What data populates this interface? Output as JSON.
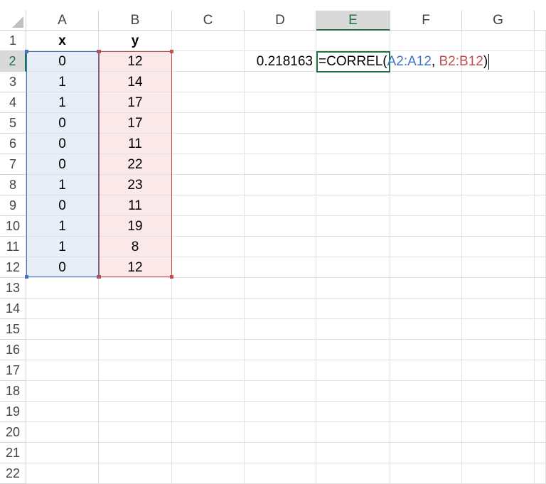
{
  "columns": [
    "A",
    "B",
    "C",
    "D",
    "E",
    "F",
    "G"
  ],
  "active_column": "E",
  "rows": [
    "1",
    "2",
    "3",
    "4",
    "5",
    "6",
    "7",
    "8",
    "9",
    "10",
    "11",
    "12",
    "13",
    "14",
    "15",
    "16",
    "17",
    "18",
    "19",
    "20",
    "21",
    "22"
  ],
  "active_row": "2",
  "headers": {
    "a1": "x",
    "b1": "y"
  },
  "col_a": [
    "0",
    "1",
    "1",
    "0",
    "0",
    "0",
    "1",
    "0",
    "1",
    "1",
    "0"
  ],
  "col_b": [
    "12",
    "14",
    "17",
    "17",
    "11",
    "22",
    "23",
    "11",
    "19",
    "8",
    "12"
  ],
  "d2_value": "0.218163",
  "formula": {
    "prefix": "=CORREL(",
    "range1": "A2:A12",
    "sep": ", ",
    "range2": "B2:B12",
    "suffix": ")"
  },
  "colors": {
    "accent_green": "#217346",
    "range1_color": "#4472c4",
    "range2_color": "#c0504d"
  }
}
